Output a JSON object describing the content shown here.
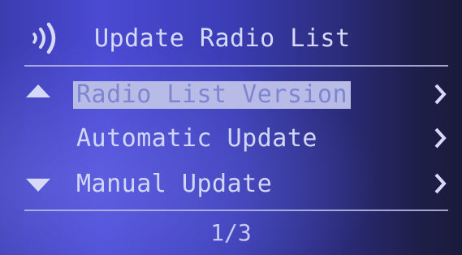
{
  "header": {
    "title": "Update Radio List",
    "icon": "radio-signal-icon"
  },
  "menu": {
    "items": [
      {
        "label": "Radio List Version",
        "selected": true,
        "icon": "chevron-right-icon"
      },
      {
        "label": "Automatic Update",
        "selected": false,
        "icon": "chevron-right-icon"
      },
      {
        "label": "Manual Update",
        "selected": false,
        "icon": "chevron-right-icon"
      }
    ],
    "scroll_up_icon": "triangle-up-icon",
    "scroll_down_icon": "triangle-down-icon"
  },
  "footer": {
    "page_indicator": "1/3"
  },
  "colors": {
    "background": "#4a4ad4",
    "text": "#d3d7f7",
    "highlight": "#b7bbe6"
  }
}
